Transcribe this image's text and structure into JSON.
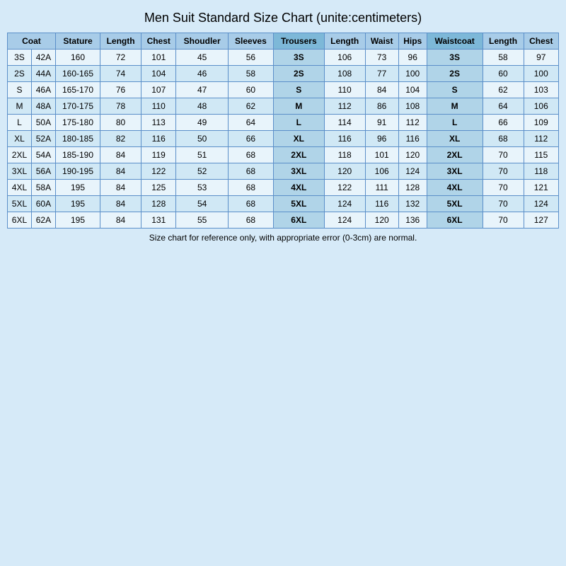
{
  "title": "Men Suit Standard Size Chart   (unite:centimeters)",
  "headers": {
    "coat": "Coat",
    "stature": "Stature",
    "length": "Length",
    "chest": "Chest",
    "shoulder": "Shoudler",
    "sleeves": "Sleeves",
    "trousers": "Trousers",
    "t_length": "Length",
    "waist": "Waist",
    "hips": "Hips",
    "waistcoat": "Waistcoat",
    "w_length": "Length",
    "w_chest": "Chest"
  },
  "rows": [
    {
      "coat": "3S",
      "code": "42A",
      "stature": "160",
      "length": "72",
      "chest": "101",
      "shoulder": "45",
      "sleeves": "56",
      "trousers": "3S",
      "t_length": "106",
      "waist": "73",
      "hips": "96",
      "waistcoat": "3S",
      "w_length": "58",
      "w_chest": "97"
    },
    {
      "coat": "2S",
      "code": "44A",
      "stature": "160-165",
      "length": "74",
      "chest": "104",
      "shoulder": "46",
      "sleeves": "58",
      "trousers": "2S",
      "t_length": "108",
      "waist": "77",
      "hips": "100",
      "waistcoat": "2S",
      "w_length": "60",
      "w_chest": "100"
    },
    {
      "coat": "S",
      "code": "46A",
      "stature": "165-170",
      "length": "76",
      "chest": "107",
      "shoulder": "47",
      "sleeves": "60",
      "trousers": "S",
      "t_length": "110",
      "waist": "84",
      "hips": "104",
      "waistcoat": "S",
      "w_length": "62",
      "w_chest": "103"
    },
    {
      "coat": "M",
      "code": "48A",
      "stature": "170-175",
      "length": "78",
      "chest": "110",
      "shoulder": "48",
      "sleeves": "62",
      "trousers": "M",
      "t_length": "112",
      "waist": "86",
      "hips": "108",
      "waistcoat": "M",
      "w_length": "64",
      "w_chest": "106"
    },
    {
      "coat": "L",
      "code": "50A",
      "stature": "175-180",
      "length": "80",
      "chest": "113",
      "shoulder": "49",
      "sleeves": "64",
      "trousers": "L",
      "t_length": "114",
      "waist": "91",
      "hips": "112",
      "waistcoat": "L",
      "w_length": "66",
      "w_chest": "109"
    },
    {
      "coat": "XL",
      "code": "52A",
      "stature": "180-185",
      "length": "82",
      "chest": "116",
      "shoulder": "50",
      "sleeves": "66",
      "trousers": "XL",
      "t_length": "116",
      "waist": "96",
      "hips": "116",
      "waistcoat": "XL",
      "w_length": "68",
      "w_chest": "112"
    },
    {
      "coat": "2XL",
      "code": "54A",
      "stature": "185-190",
      "length": "84",
      "chest": "119",
      "shoulder": "51",
      "sleeves": "68",
      "trousers": "2XL",
      "t_length": "118",
      "waist": "101",
      "hips": "120",
      "waistcoat": "2XL",
      "w_length": "70",
      "w_chest": "115"
    },
    {
      "coat": "3XL",
      "code": "56A",
      "stature": "190-195",
      "length": "84",
      "chest": "122",
      "shoulder": "52",
      "sleeves": "68",
      "trousers": "3XL",
      "t_length": "120",
      "waist": "106",
      "hips": "124",
      "waistcoat": "3XL",
      "w_length": "70",
      "w_chest": "118"
    },
    {
      "coat": "4XL",
      "code": "58A",
      "stature": "195",
      "length": "84",
      "chest": "125",
      "shoulder": "53",
      "sleeves": "68",
      "trousers": "4XL",
      "t_length": "122",
      "waist": "111",
      "hips": "128",
      "waistcoat": "4XL",
      "w_length": "70",
      "w_chest": "121"
    },
    {
      "coat": "5XL",
      "code": "60A",
      "stature": "195",
      "length": "84",
      "chest": "128",
      "shoulder": "54",
      "sleeves": "68",
      "trousers": "5XL",
      "t_length": "124",
      "waist": "116",
      "hips": "132",
      "waistcoat": "5XL",
      "w_length": "70",
      "w_chest": "124"
    },
    {
      "coat": "6XL",
      "code": "62A",
      "stature": "195",
      "length": "84",
      "chest": "131",
      "shoulder": "55",
      "sleeves": "68",
      "trousers": "6XL",
      "t_length": "124",
      "waist": "120",
      "hips": "136",
      "waistcoat": "6XL",
      "w_length": "70",
      "w_chest": "127"
    }
  ],
  "footer": "Size chart for reference only, with appropriate error (0-3cm) are normal."
}
